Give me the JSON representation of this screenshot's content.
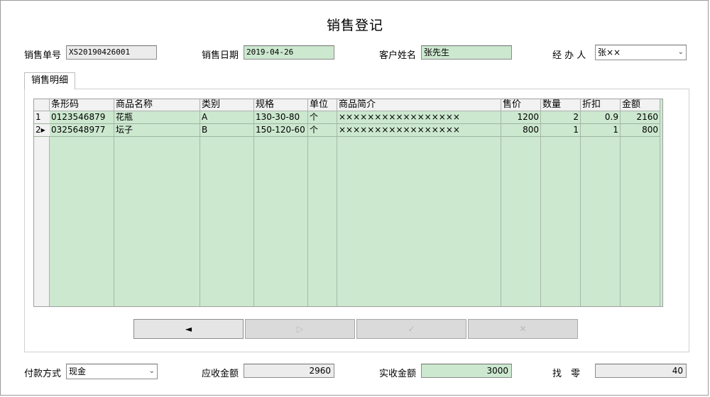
{
  "title": "销售登记",
  "header": {
    "order_no_label": "销售单号",
    "order_no": "XS20190426001",
    "date_label": "销售日期",
    "date": "2019-04-26",
    "customer_label": "客户姓名",
    "customer": "张先生",
    "handler_label": "经 办 人",
    "handler": "张××"
  },
  "tab_label": "销售明细",
  "grid": {
    "columns": [
      "条形码",
      "商品名称",
      "类别",
      "规格",
      "单位",
      "商品简介",
      "售价",
      "数量",
      "折扣",
      "金额"
    ],
    "rows": [
      {
        "index": "1",
        "barcode": "0123546879",
        "name": "花瓶",
        "category": "A",
        "spec": "130-30-80",
        "unit": "个",
        "desc": "×××××××××××××××××",
        "price": "1200",
        "qty": "2",
        "discount": "0.9",
        "amount": "2160"
      },
      {
        "index": "2",
        "barcode": "0325648977",
        "name": "坛子",
        "category": "B",
        "spec": "150-120-60",
        "unit": "个",
        "desc": "×××××××××××××××××",
        "price": "800",
        "qty": "1",
        "discount": "1",
        "amount": "800"
      }
    ],
    "selected_row_indicator": "▶"
  },
  "nav_buttons": {
    "prev": "◄",
    "next": "▷",
    "confirm": "✓",
    "delete": "✕"
  },
  "footer": {
    "payment_label": "付款方式",
    "payment": "现金",
    "receivable_label": "应收金额",
    "receivable": "2960",
    "received_label": "实收金额",
    "received": "3000",
    "change_label": "找　零",
    "change": "40"
  }
}
